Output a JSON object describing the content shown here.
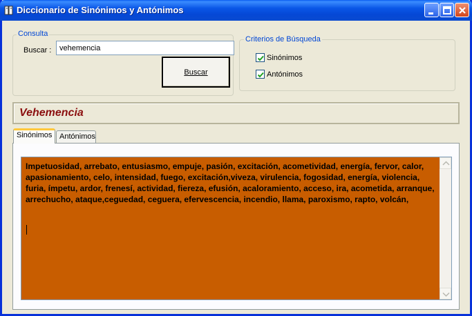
{
  "window": {
    "title": "Diccionario de Sinónimos y Antónimos"
  },
  "consulta": {
    "group_label": "Consulta",
    "buscar_label": "Buscar :",
    "search_value": "vehemencia",
    "buscar_button": "Buscar"
  },
  "criterios": {
    "group_label": "Criterios de Búsqueda",
    "sinonimos_label": "Sinónimos",
    "sinonimos_checked": true,
    "antonimos_label": "Antónimos",
    "antonimos_checked": true
  },
  "result": {
    "word": "Vehemencia"
  },
  "tabs": [
    {
      "label": "Sinónimos",
      "active": true
    },
    {
      "label": "Antónimos",
      "active": false
    }
  ],
  "content": {
    "text": "Impetuosidad, arrebato, entusiasmo, empuje, pasión, excitación, acometividad, energía, fervor, calor, apasionamiento, celo, intensidad, fuego, excitación,viveza, virulencia, fogosidad, energía, violencia, furia, ímpetu, ardor, frenesí, actividad, fiereza, efusión, acaloramiento, acceso, ira, acometida, arranque, arrechucho, ataque,ceguedad, ceguera, efervescencia, incendio, llama, paroxismo, rapto, volcán,",
    "background_color": "#c85d00"
  }
}
